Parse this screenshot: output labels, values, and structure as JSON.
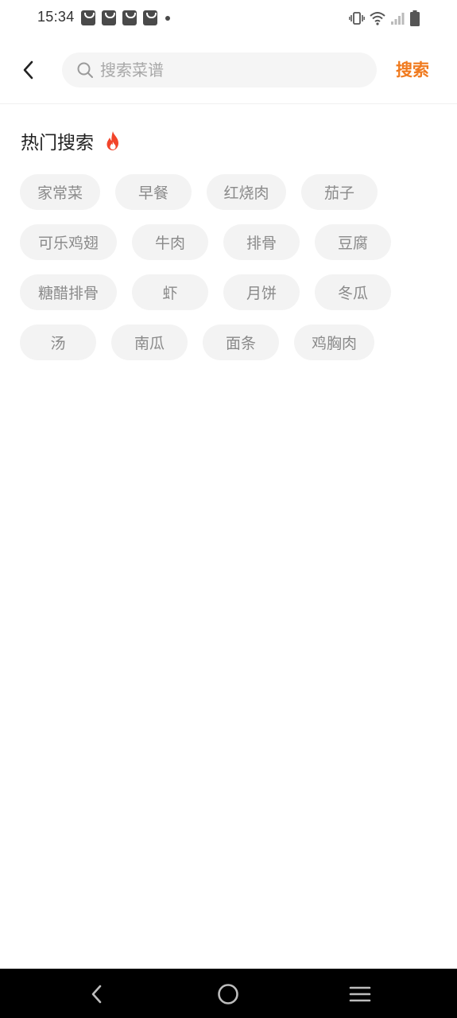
{
  "status_bar": {
    "time": "15:34",
    "notification_icons": [
      "shopping-bag-icon",
      "shopping-bag-icon",
      "shopping-bag-icon",
      "shopping-bag-icon"
    ],
    "system_icons": [
      "vibrate-icon",
      "wifi-icon",
      "signal-icon",
      "battery-icon"
    ]
  },
  "header": {
    "search_placeholder": "搜索菜谱",
    "search_value": "",
    "search_button_label": "搜索",
    "accent_color": "#f07a1e"
  },
  "hot_search": {
    "title": "热门搜索",
    "icon": "fire-icon",
    "rows": [
      [
        "家常菜",
        "早餐",
        "红烧肉",
        "茄子"
      ],
      [
        "可乐鸡翅",
        "牛肉",
        "排骨",
        "豆腐"
      ],
      [
        "糖醋排骨",
        "虾",
        "月饼",
        "冬瓜"
      ],
      [
        "汤",
        "南瓜",
        "面条",
        "鸡胸肉"
      ]
    ]
  },
  "nav_bar": {
    "buttons": [
      "back-icon",
      "home-icon",
      "menu-icon"
    ]
  }
}
